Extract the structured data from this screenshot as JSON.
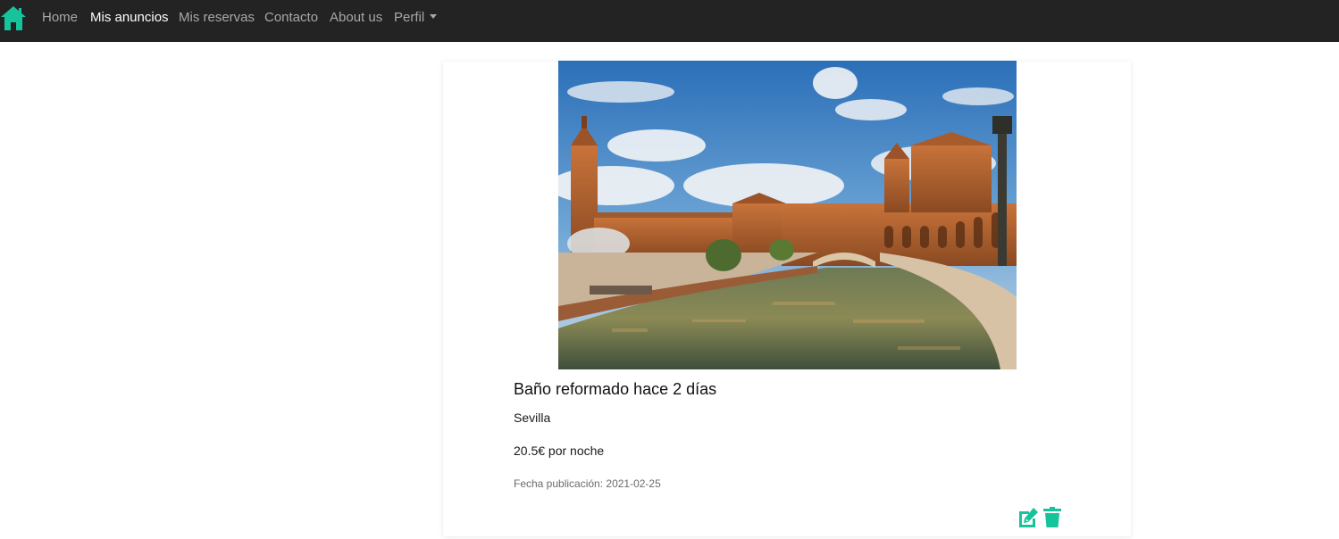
{
  "nav": {
    "brand_icon": "home-icon",
    "items": [
      {
        "label": "Home",
        "active": false
      },
      {
        "label": "Mis anuncios",
        "active": true
      },
      {
        "label": "Mis reservas",
        "active": false
      },
      {
        "label": "Contacto",
        "active": false
      },
      {
        "label": "About us",
        "active": false
      }
    ],
    "profile_label": "Perfil"
  },
  "listing": {
    "image_icon": "plaza-de-espana-photo",
    "title": "Baño reformado hace 2 días",
    "city": "Sevilla",
    "price": "20.5€ por noche",
    "published": "Fecha publicación: 2021-02-25",
    "actions": {
      "edit_icon": "edit-icon",
      "delete_icon": "trash-icon"
    }
  },
  "colors": {
    "navbar_bg": "#232323",
    "accent": "#17c39b",
    "nav_link": "#a8a8a8",
    "nav_link_active": "#ffffff"
  }
}
